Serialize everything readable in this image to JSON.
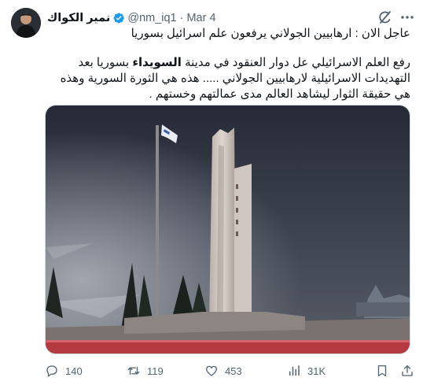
{
  "author": {
    "name": "نمير الكواك",
    "handle": "@nm_iq1",
    "separator": "·",
    "date": "Mar 4",
    "verified": true
  },
  "tweet": {
    "headline": "عاجل الان : ارهابيين الجولاني يرفعون علم اسرائيل بسوريا",
    "para_part1": "رفع العلم الاسرائيلي عل دوار العنقود في مدينة ",
    "para_bold": "السويداء",
    "para_part2": " بسوريا بعد التهديدات الاسرائيلية لارهابيين الجولاني ..... هذه هي الثورة السورية وهذه هي حقيقة الثوار ليشاهد العالم مدى عمالتهم وخستهم ."
  },
  "media": {
    "icon": "photo-of-monument-with-flag"
  },
  "stats": {
    "replies": "140",
    "reposts": "119",
    "likes": "453",
    "views": "31K"
  },
  "colors": {
    "text": "#0f1419",
    "muted": "#536471",
    "verified": "#1d9bf0",
    "border": "#cfd9de"
  },
  "icons": [
    "grok-icon",
    "more-icon",
    "verified-icon",
    "reply-icon",
    "repost-icon",
    "like-icon",
    "views-icon",
    "bookmark-icon",
    "share-icon"
  ]
}
